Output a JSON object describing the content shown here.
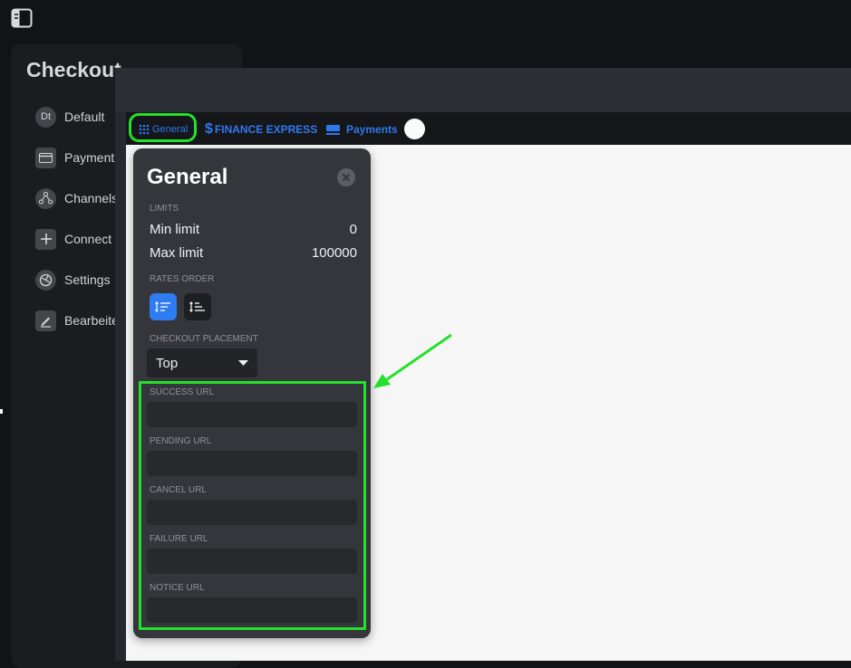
{
  "sidebar": {
    "title": "Checkout",
    "items": [
      {
        "label": "Default",
        "icon": "dt-avatar-icon",
        "icon_text": "Dt"
      },
      {
        "label": "Payment",
        "icon": "card-icon"
      },
      {
        "label": "Channels",
        "icon": "network-icon"
      },
      {
        "label": "Connect",
        "icon": "plus-icon"
      },
      {
        "label": "Settings",
        "icon": "settings-icon"
      },
      {
        "label": "Bearbeite",
        "icon": "edit-icon"
      }
    ]
  },
  "tabs": [
    {
      "label": "General",
      "icon": "grid-dots-icon",
      "highlighted": true
    },
    {
      "label": "FINANCE EXPRESS",
      "icon": "dollar-icon"
    },
    {
      "label": "Payments",
      "icon": "card-icon"
    }
  ],
  "popup": {
    "title": "General",
    "limits_heading": "LIMITS",
    "min_label": "Min limit",
    "min_value": "0",
    "max_label": "Max limit",
    "max_value": "100000",
    "rates_heading": "RATES ORDER",
    "placement_heading": "CHECKOUT PLACEMENT",
    "placement_value": "Top",
    "url_fields": [
      {
        "label": "SUCCESS URL",
        "value": ""
      },
      {
        "label": "PENDING URL",
        "value": ""
      },
      {
        "label": "CANCEL URL",
        "value": ""
      },
      {
        "label": "FAILURE URL",
        "value": ""
      },
      {
        "label": "NOTICE URL",
        "value": ""
      }
    ]
  },
  "colors": {
    "accent_blue": "#2f79ee",
    "highlight_green": "#22e12a",
    "popup_bg": "#34363c",
    "content_bg": "#f6f6f6"
  }
}
